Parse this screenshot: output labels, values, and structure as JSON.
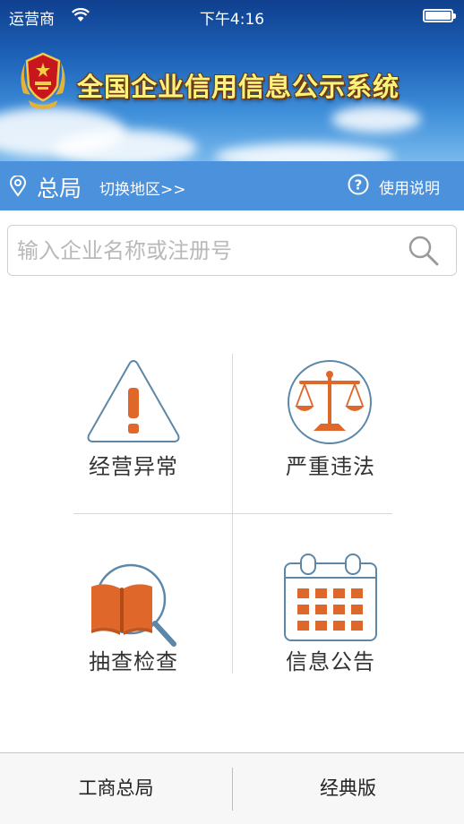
{
  "status_bar": {
    "carrier": "运营商",
    "time": "下午4:16"
  },
  "header": {
    "title": "全国企业信用信息公示系统"
  },
  "location_bar": {
    "region": "总局",
    "switch_label": "切换地区>>",
    "help_label": "使用说明"
  },
  "search": {
    "placeholder": "输入企业名称或注册号"
  },
  "tiles": [
    {
      "label": "经营异常",
      "icon": "warning-triangle-icon"
    },
    {
      "label": "严重违法",
      "icon": "scales-of-justice-icon"
    },
    {
      "label": "抽查检查",
      "icon": "book-magnifier-icon"
    },
    {
      "label": "信息公告",
      "icon": "calendar-icon"
    }
  ],
  "bottom_tabs": [
    {
      "label": "工商总局"
    },
    {
      "label": "经典版"
    }
  ],
  "colors": {
    "accent_blue": "#4b91dc",
    "icon_orange": "#e0672a",
    "icon_outline": "#5c87a8",
    "title_yellow": "#fbf27b"
  }
}
